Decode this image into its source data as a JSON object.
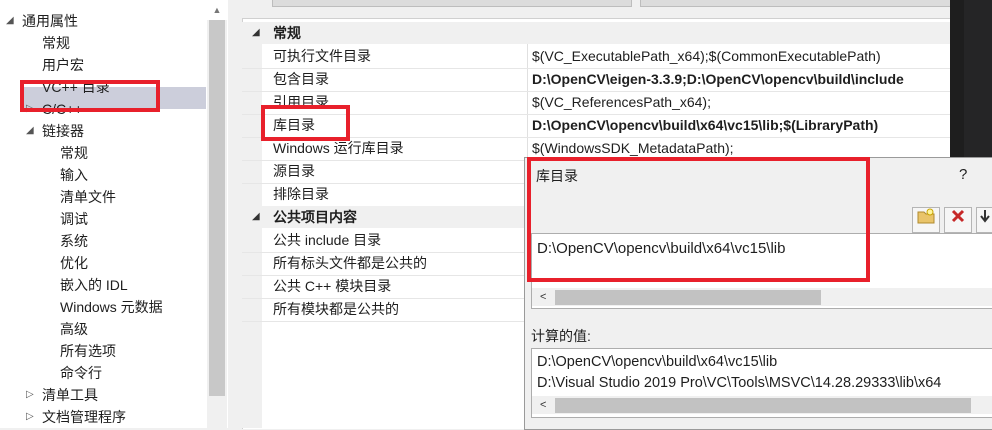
{
  "tree": {
    "items": [
      {
        "label": "通用属性",
        "arrow": "◢",
        "indent": 0
      },
      {
        "label": "常规",
        "arrow": "",
        "indent": 1
      },
      {
        "label": "用户宏",
        "arrow": "",
        "indent": 1
      },
      {
        "label": "VC++ 目录",
        "arrow": "",
        "indent": 1
      },
      {
        "label": "C/C++",
        "arrow": "▷",
        "indent": 1
      },
      {
        "label": "链接器",
        "arrow": "◢",
        "indent": 1
      },
      {
        "label": "常规",
        "arrow": "",
        "indent": 2
      },
      {
        "label": "输入",
        "arrow": "",
        "indent": 2
      },
      {
        "label": "清单文件",
        "arrow": "",
        "indent": 2
      },
      {
        "label": "调试",
        "arrow": "",
        "indent": 2
      },
      {
        "label": "系统",
        "arrow": "",
        "indent": 2
      },
      {
        "label": "优化",
        "arrow": "",
        "indent": 2
      },
      {
        "label": "嵌入的 IDL",
        "arrow": "",
        "indent": 2
      },
      {
        "label": "Windows 元数据",
        "arrow": "",
        "indent": 2
      },
      {
        "label": "高级",
        "arrow": "",
        "indent": 2
      },
      {
        "label": "所有选项",
        "arrow": "",
        "indent": 2
      },
      {
        "label": "命令行",
        "arrow": "",
        "indent": 2
      },
      {
        "label": "清单工具",
        "arrow": "▷",
        "indent": 1
      },
      {
        "label": "文档管理程序",
        "arrow": "▷",
        "indent": 1
      }
    ],
    "selected_label": "VC++ 目录"
  },
  "grid": {
    "group_general": "常规",
    "group_public": "公共项目内容",
    "general_rows": [
      {
        "name": "可执行文件目录",
        "value": "$(VC_ExecutablePath_x64);$(CommonExecutablePath)",
        "bold": false
      },
      {
        "name": "包含目录",
        "value": "D:\\OpenCV\\eigen-3.3.9;D:\\OpenCV\\opencv\\build\\include",
        "bold": true
      },
      {
        "name": "引用目录",
        "value": "$(VC_ReferencesPath_x64);",
        "bold": false
      },
      {
        "name": "库目录",
        "value": "D:\\OpenCV\\opencv\\build\\x64\\vc15\\lib;$(LibraryPath)",
        "bold": true
      },
      {
        "name": "Windows 运行库目录",
        "value": "$(WindowsSDK_MetadataPath);",
        "bold": false
      },
      {
        "name": "源目录",
        "value": "",
        "bold": false
      },
      {
        "name": "排除目录",
        "value": "",
        "bold": false
      }
    ],
    "public_rows": [
      {
        "name": "公共 include 目录",
        "value": ""
      },
      {
        "name": "所有标头文件都是公共的",
        "value": ""
      },
      {
        "name": "公共 C++ 模块目录",
        "value": ""
      },
      {
        "name": "所有模块都是公共的",
        "value": ""
      }
    ]
  },
  "dialog": {
    "title": "库目录",
    "help": "?",
    "edit_value": "D:\\OpenCV\\opencv\\build\\x64\\vc15\\lib",
    "calc_label": "计算的值:",
    "calc_lines": [
      "D:\\OpenCV\\opencv\\build\\x64\\vc15\\lib",
      "D:\\Visual Studio 2019 Pro\\VC\\Tools\\MSVC\\14.28.29333\\lib\\x64"
    ],
    "scroll_left": "<"
  },
  "colors": {
    "highlight": "#e8202b",
    "selection": "#cccedb"
  }
}
